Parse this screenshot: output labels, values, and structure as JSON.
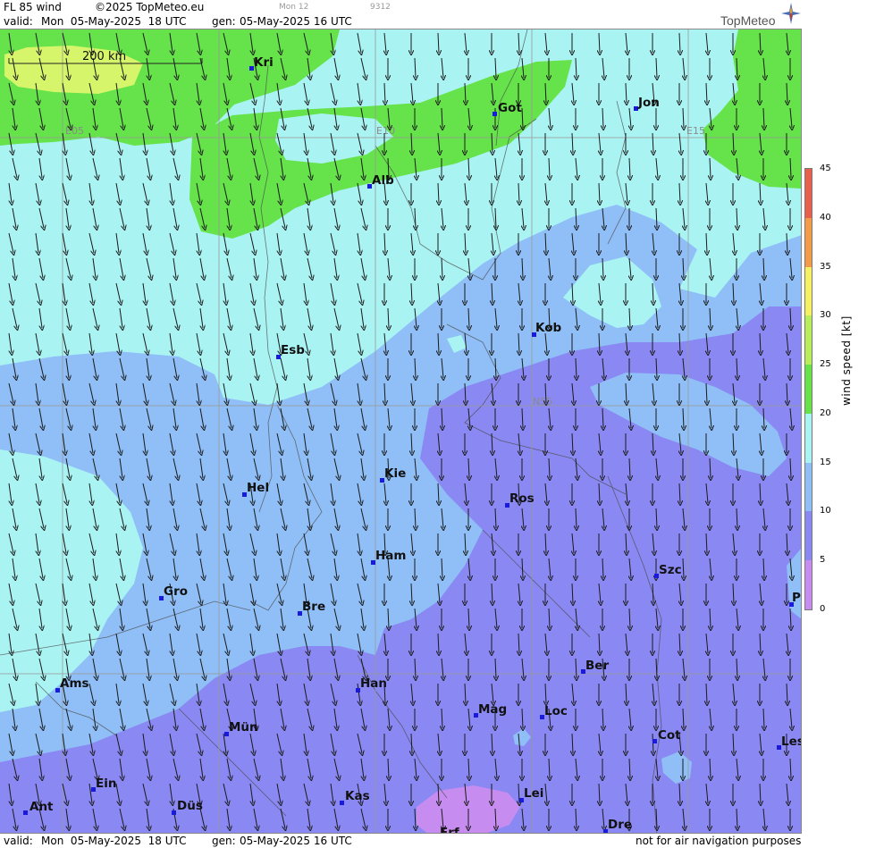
{
  "header": {
    "product": "FL 85 wind",
    "copyright": "©2025 TopMeteo.eu",
    "faint_day": "Mon 12",
    "faint_code": "9312",
    "valid_label": "valid:",
    "valid_time": "Mon  05-May-2025  18 UTC",
    "gen_label": "gen:",
    "gen_time": "05-May-2025 16 UTC"
  },
  "logo": {
    "text": "TopMeteo",
    "icon": "compass-star-icon"
  },
  "footer": {
    "valid_label": "valid:",
    "valid_time": "Mon  05-May-2025  18 UTC",
    "gen_label": "gen:",
    "gen_time": "05-May-2025 16 UTC",
    "disclaimer": "not for air navigation purposes"
  },
  "scale_bar": {
    "label": "200 km"
  },
  "grid_labels": [
    {
      "text": "E05"
    },
    {
      "text": "E10"
    },
    {
      "text": "E15"
    },
    {
      "text": "N55"
    }
  ],
  "cities": [
    {
      "name": "Kri"
    },
    {
      "name": "Got"
    },
    {
      "name": "Jon"
    },
    {
      "name": "Alb"
    },
    {
      "name": "Kob"
    },
    {
      "name": "Esb"
    },
    {
      "name": "Kie"
    },
    {
      "name": "Hel"
    },
    {
      "name": "Ros"
    },
    {
      "name": "Ham"
    },
    {
      "name": "Szc"
    },
    {
      "name": "Gro"
    },
    {
      "name": "Bre"
    },
    {
      "name": "P"
    },
    {
      "name": "Ber"
    },
    {
      "name": "Ams"
    },
    {
      "name": "Han"
    },
    {
      "name": "Mag"
    },
    {
      "name": "Loc"
    },
    {
      "name": "Mün"
    },
    {
      "name": "Cot"
    },
    {
      "name": "Les"
    },
    {
      "name": "Ein"
    },
    {
      "name": "Lei"
    },
    {
      "name": "Kas"
    },
    {
      "name": "Ant"
    },
    {
      "name": "Düs"
    },
    {
      "name": "Dre"
    },
    {
      "name": "Erf"
    }
  ],
  "legend": {
    "title": "wind speed [kt]",
    "ticks": [
      "45",
      "40",
      "35",
      "30",
      "25",
      "20",
      "15",
      "10",
      "5",
      "0"
    ],
    "bands": [
      {
        "from": 40,
        "to": 45,
        "color": "#e8604c"
      },
      {
        "from": 35,
        "to": 40,
        "color": "#f59a4a"
      },
      {
        "from": 30,
        "to": 35,
        "color": "#f7f060"
      },
      {
        "from": 25,
        "to": 30,
        "color": "#b8ee5a"
      },
      {
        "from": 20,
        "to": 25,
        "color": "#66e24a"
      },
      {
        "from": 15,
        "to": 20,
        "color": "#aaf3f3"
      },
      {
        "from": 10,
        "to": 15,
        "color": "#8fbff6"
      },
      {
        "from": 5,
        "to": 10,
        "color": "#8a88f2"
      },
      {
        "from": 0,
        "to": 5,
        "color": "#c68cf0"
      }
    ]
  },
  "colors": {
    "very_light_green": "#d6f56a",
    "green": "#66e24a",
    "cyan": "#aaf3f3",
    "light_blue": "#8fbff6",
    "blue_purple": "#8a88f2",
    "violet": "#c68cf0",
    "city_marker": "#1a1adb"
  }
}
